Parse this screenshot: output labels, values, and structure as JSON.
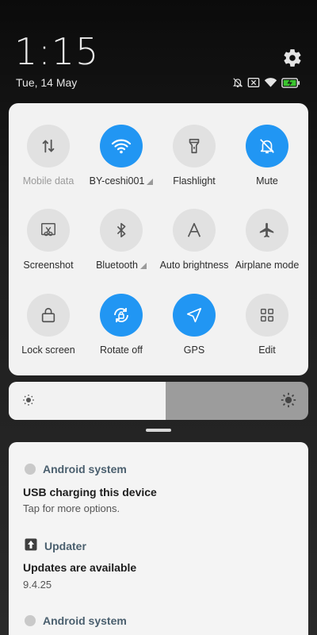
{
  "header": {
    "time": "1:15",
    "date": "Tue, 14 May"
  },
  "icons": {
    "settings": "gear-icon",
    "status": [
      "mute-bell-icon",
      "no-sim-icon",
      "wifi-icon",
      "battery-charging-icon"
    ]
  },
  "colors": {
    "accent": "#2196f3",
    "panel": "#f2f2f2",
    "battery": "#3ac42e"
  },
  "tiles": [
    {
      "label": "Mobile data",
      "icon": "mobile-data-icon",
      "state": "disabled"
    },
    {
      "label": "BY-ceshi001",
      "icon": "wifi-icon",
      "state": "on"
    },
    {
      "label": "Flashlight",
      "icon": "flashlight-icon",
      "state": "off"
    },
    {
      "label": "Mute",
      "icon": "mute-icon",
      "state": "on"
    },
    {
      "label": "Screenshot",
      "icon": "screenshot-icon",
      "state": "off"
    },
    {
      "label": "Bluetooth",
      "icon": "bluetooth-icon",
      "state": "off"
    },
    {
      "label": "Auto brightness",
      "icon": "auto-brightness-icon",
      "state": "off"
    },
    {
      "label": "Airplane mode",
      "icon": "airplane-icon",
      "state": "off"
    },
    {
      "label": "Lock screen",
      "icon": "lock-icon",
      "state": "off"
    },
    {
      "label": "Rotate off",
      "icon": "rotate-lock-icon",
      "state": "on"
    },
    {
      "label": "GPS",
      "icon": "gps-icon",
      "state": "on"
    },
    {
      "label": "Edit",
      "icon": "grid-icon",
      "state": "off"
    }
  ],
  "brightness": {
    "level": 0.525
  },
  "notifications": [
    {
      "app": "Android system",
      "title": "USB charging this device",
      "text": "Tap for more options."
    },
    {
      "app": "Updater",
      "title": "Updates are available",
      "text": "9.4.25"
    },
    {
      "app": "Android system"
    }
  ]
}
